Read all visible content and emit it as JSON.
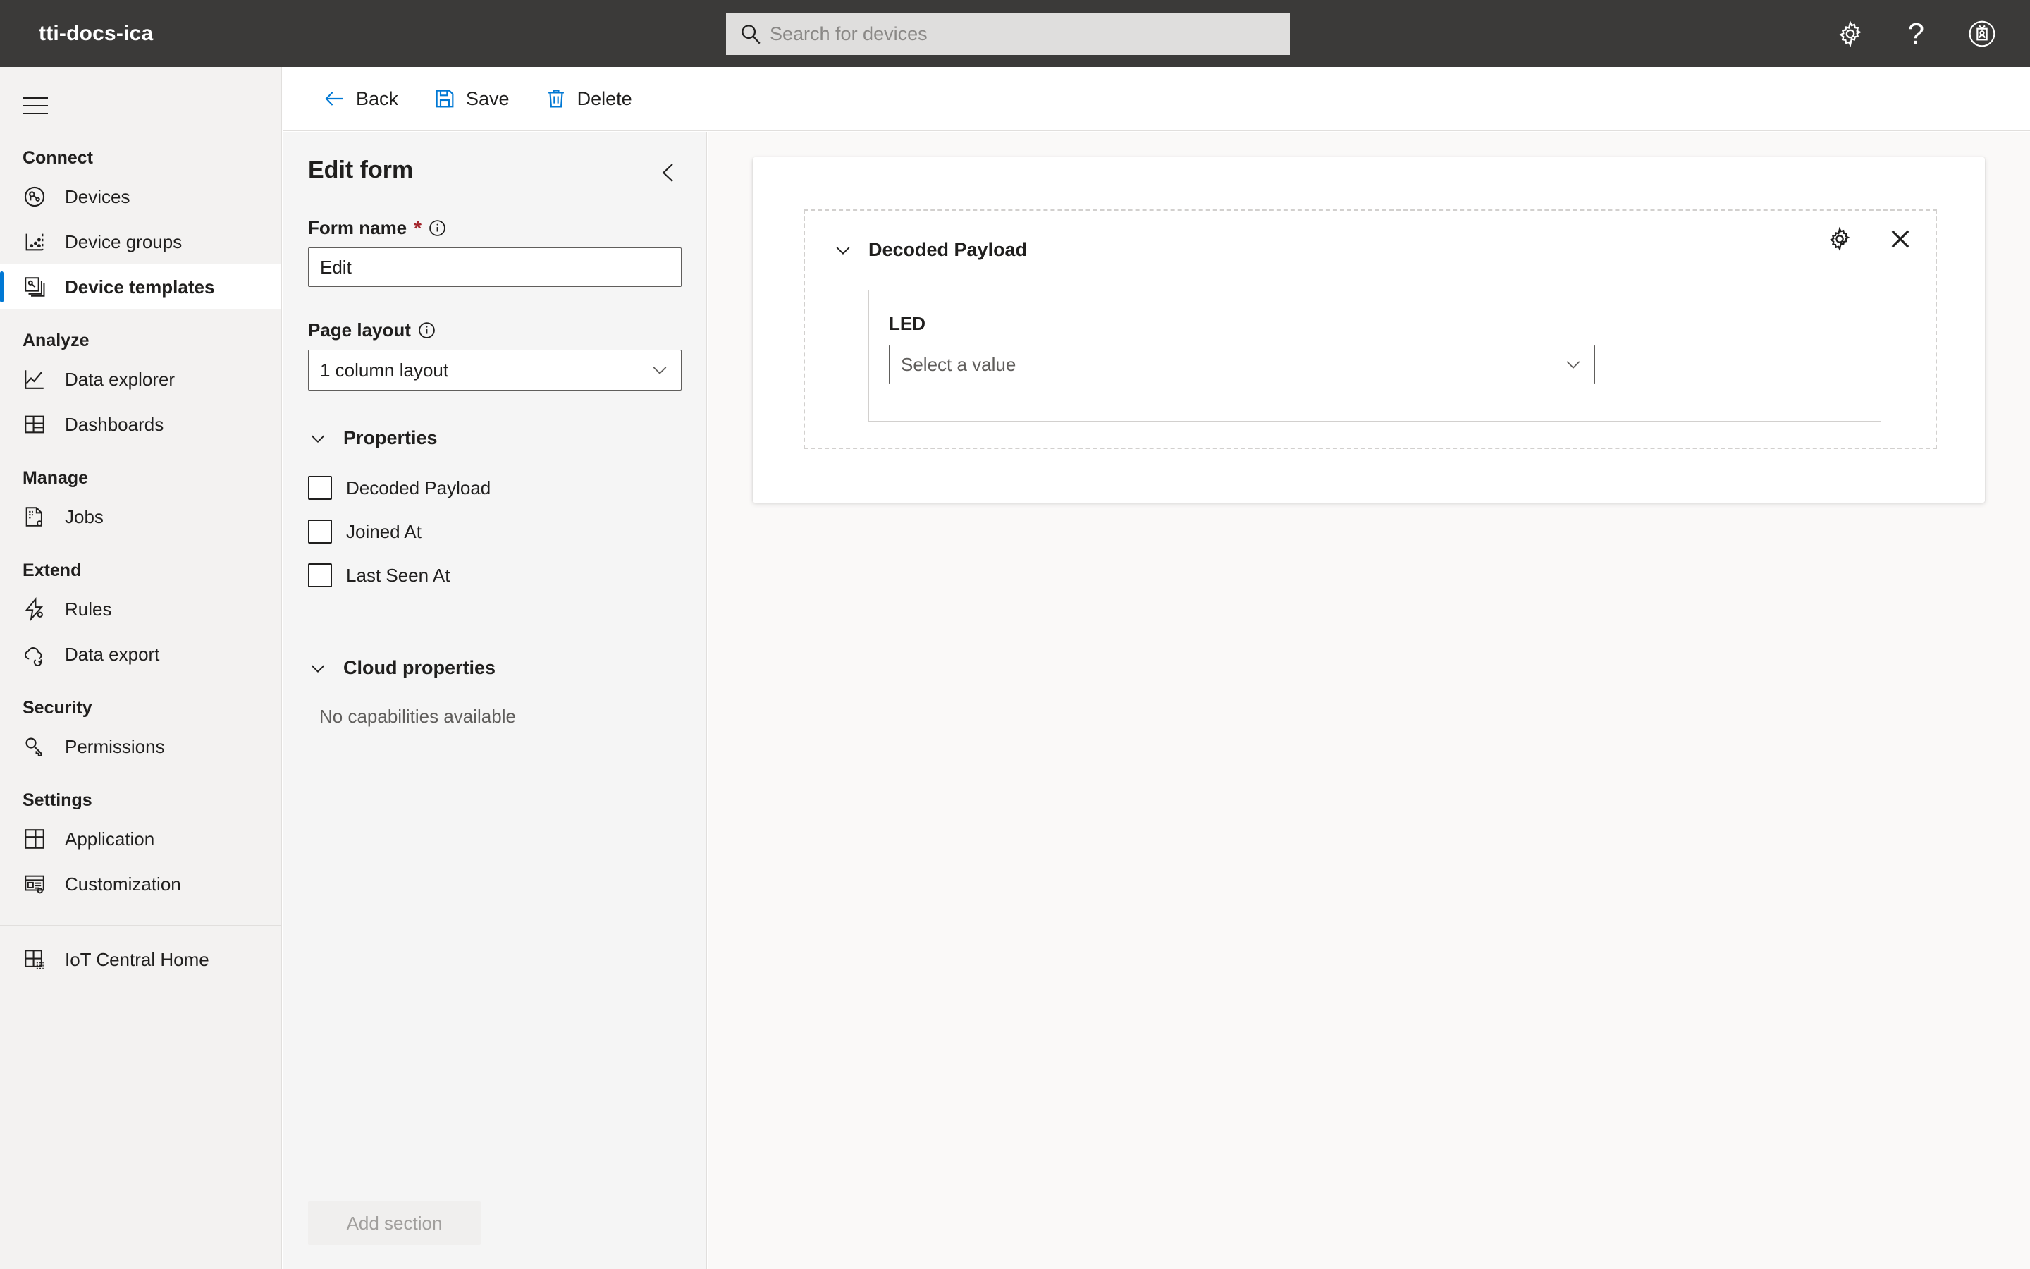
{
  "topbar": {
    "app_title": "tti-docs-ica",
    "search": {
      "placeholder": "Search for devices",
      "value": "",
      "icon": "search-icon"
    },
    "settings_icon": "gear-icon",
    "help_icon": "help-question-icon",
    "help_glyph": "?",
    "account_icon": "account-badge-icon"
  },
  "sidebar": {
    "menu_icon": "hamburger-menu-icon",
    "groups": [
      {
        "title": "Connect",
        "items": [
          {
            "label": "Devices",
            "icon": "devices-icon",
            "selected": false
          },
          {
            "label": "Device groups",
            "icon": "device-groups-icon",
            "selected": false
          },
          {
            "label": "Device templates",
            "icon": "device-templates-icon",
            "selected": true
          }
        ]
      },
      {
        "title": "Analyze",
        "items": [
          {
            "label": "Data explorer",
            "icon": "data-explorer-icon",
            "selected": false
          },
          {
            "label": "Dashboards",
            "icon": "dashboards-icon",
            "selected": false
          }
        ]
      },
      {
        "title": "Manage",
        "items": [
          {
            "label": "Jobs",
            "icon": "jobs-icon",
            "selected": false
          }
        ]
      },
      {
        "title": "Extend",
        "items": [
          {
            "label": "Rules",
            "icon": "rules-icon",
            "selected": false
          },
          {
            "label": "Data export",
            "icon": "data-export-icon",
            "selected": false
          }
        ]
      },
      {
        "title": "Security",
        "items": [
          {
            "label": "Permissions",
            "icon": "permissions-key-icon",
            "selected": false
          }
        ]
      },
      {
        "title": "Settings",
        "items": [
          {
            "label": "Application",
            "icon": "application-icon",
            "selected": false
          },
          {
            "label": "Customization",
            "icon": "customization-icon",
            "selected": false
          }
        ]
      }
    ],
    "footer_item": {
      "label": "IoT Central Home",
      "icon": "iot-central-home-icon"
    }
  },
  "toolbar": {
    "back_label": "Back",
    "back_icon": "arrow-left-icon",
    "save_label": "Save",
    "save_icon": "save-disk-icon",
    "delete_label": "Delete",
    "delete_icon": "trash-icon",
    "accent_color": "#0078D4"
  },
  "panel": {
    "title": "Edit form",
    "collapse_icon": "chevron-left-icon",
    "form_name": {
      "label": "Form name",
      "required_marker": "*",
      "info_icon": "info-icon",
      "value": "Edit",
      "placeholder": ""
    },
    "page_layout": {
      "label": "Page layout",
      "info_icon": "info-icon",
      "selected": "1 column layout",
      "chevron_icon": "chevron-down-icon"
    },
    "properties_section": {
      "title": "Properties",
      "chevron_icon": "chevron-down-icon",
      "items": [
        {
          "label": "Decoded Payload",
          "checked": false
        },
        {
          "label": "Joined At",
          "checked": false
        },
        {
          "label": "Last Seen At",
          "checked": false
        }
      ]
    },
    "cloud_properties_section": {
      "title": "Cloud properties",
      "chevron_icon": "chevron-down-icon",
      "empty_text": "No capabilities available"
    },
    "add_section_label": "Add section"
  },
  "canvas": {
    "section": {
      "title": "Decoded Payload",
      "chevron_icon": "chevron-down-icon",
      "settings_icon": "gear-icon",
      "close_icon": "close-x-icon",
      "field": {
        "label": "LED",
        "placeholder": "Select a value",
        "chevron_icon": "chevron-down-icon"
      }
    }
  }
}
